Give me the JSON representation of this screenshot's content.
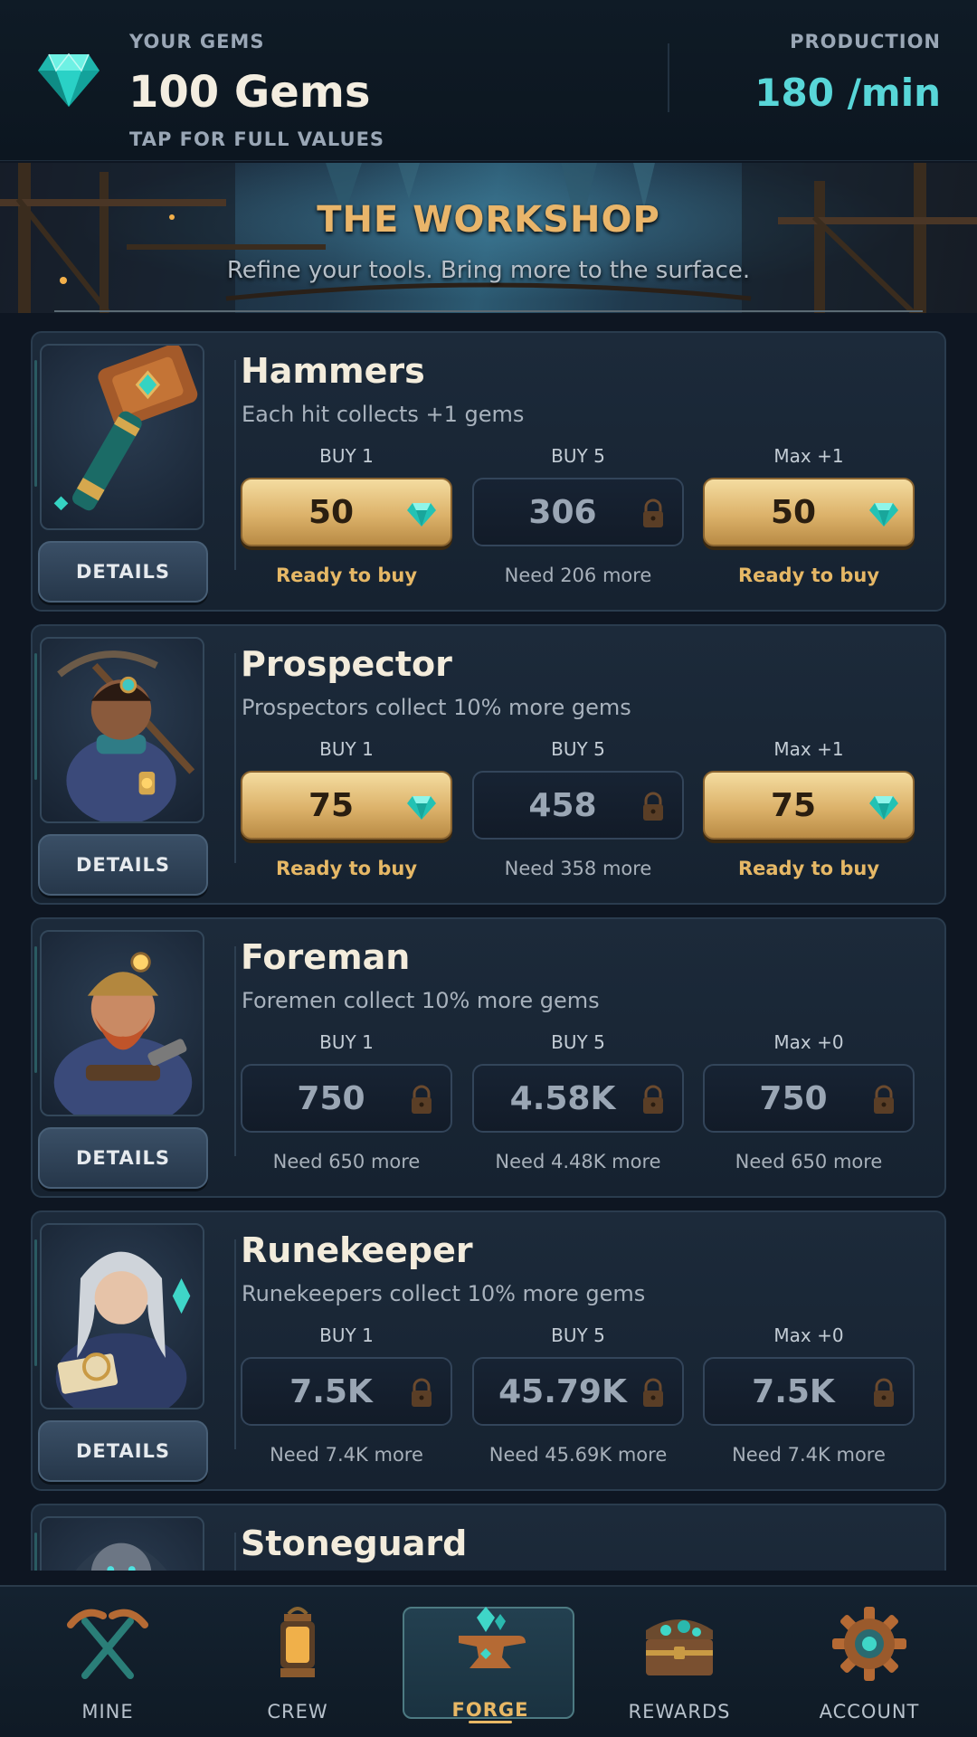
{
  "header": {
    "gems_label": "YOUR GEMS",
    "gems_value": "100 Gems",
    "gems_hint": "TAP FOR FULL VALUES",
    "production_label": "PRODUCTION",
    "production_value": "180 /min",
    "gem_icon": "gem-icon"
  },
  "banner": {
    "title": "THE WORKSHOP",
    "subtitle": "Refine your tools. Bring more to the surface."
  },
  "colors": {
    "gold": "#e6b866",
    "teal": "#58d6d8",
    "background": "#0e1622"
  },
  "upgrades": [
    {
      "title": "Hammers",
      "desc": "Each hit collects +1 gems",
      "portrait": "hammer-portrait",
      "details_label": "DETAILS",
      "options": [
        {
          "label": "BUY 1",
          "cost": "50",
          "state": "affordable",
          "icon": "gem-icon",
          "status": "Ready to buy"
        },
        {
          "label": "BUY 5",
          "cost": "306",
          "state": "locked",
          "icon": "lock-icon",
          "status": "Need 206 more"
        },
        {
          "label": "Max +1",
          "cost": "50",
          "state": "affordable",
          "icon": "gem-icon",
          "status": "Ready to buy"
        }
      ]
    },
    {
      "title": "Prospector",
      "desc": "Prospectors collect 10% more gems",
      "portrait": "prospector-portrait",
      "details_label": "DETAILS",
      "options": [
        {
          "label": "BUY 1",
          "cost": "75",
          "state": "affordable",
          "icon": "gem-icon",
          "status": "Ready to buy"
        },
        {
          "label": "BUY 5",
          "cost": "458",
          "state": "locked",
          "icon": "lock-icon",
          "status": "Need 358 more"
        },
        {
          "label": "Max +1",
          "cost": "75",
          "state": "affordable",
          "icon": "gem-icon",
          "status": "Ready to buy"
        }
      ]
    },
    {
      "title": "Foreman",
      "desc": "Foremen collect 10% more gems",
      "portrait": "foreman-portrait",
      "details_label": "DETAILS",
      "options": [
        {
          "label": "BUY 1",
          "cost": "750",
          "state": "locked",
          "icon": "lock-icon",
          "status": "Need 650 more"
        },
        {
          "label": "BUY 5",
          "cost": "4.58K",
          "state": "locked",
          "icon": "lock-icon",
          "status": "Need 4.48K more"
        },
        {
          "label": "Max +0",
          "cost": "750",
          "state": "locked",
          "icon": "lock-icon",
          "status": "Need 650 more"
        }
      ]
    },
    {
      "title": "Runekeeper",
      "desc": "Runekeepers collect 10% more gems",
      "portrait": "runekeeper-portrait",
      "details_label": "DETAILS",
      "options": [
        {
          "label": "BUY 1",
          "cost": "7.5K",
          "state": "locked",
          "icon": "lock-icon",
          "status": "Need 7.4K more"
        },
        {
          "label": "BUY 5",
          "cost": "45.79K",
          "state": "locked",
          "icon": "lock-icon",
          "status": "Need 45.69K more"
        },
        {
          "label": "Max +0",
          "cost": "7.5K",
          "state": "locked",
          "icon": "lock-icon",
          "status": "Need 7.4K more"
        }
      ]
    },
    {
      "title": "Stoneguard",
      "portrait": "stoneguard-portrait"
    }
  ],
  "nav": [
    {
      "label": "MINE",
      "icon": "pickaxes-icon",
      "active": false
    },
    {
      "label": "CREW",
      "icon": "lantern-icon",
      "active": false
    },
    {
      "label": "FORGE",
      "icon": "anvil-icon",
      "active": true
    },
    {
      "label": "REWARDS",
      "icon": "treasure-chest-icon",
      "active": false
    },
    {
      "label": "ACCOUNT",
      "icon": "gear-icon",
      "active": false
    }
  ]
}
